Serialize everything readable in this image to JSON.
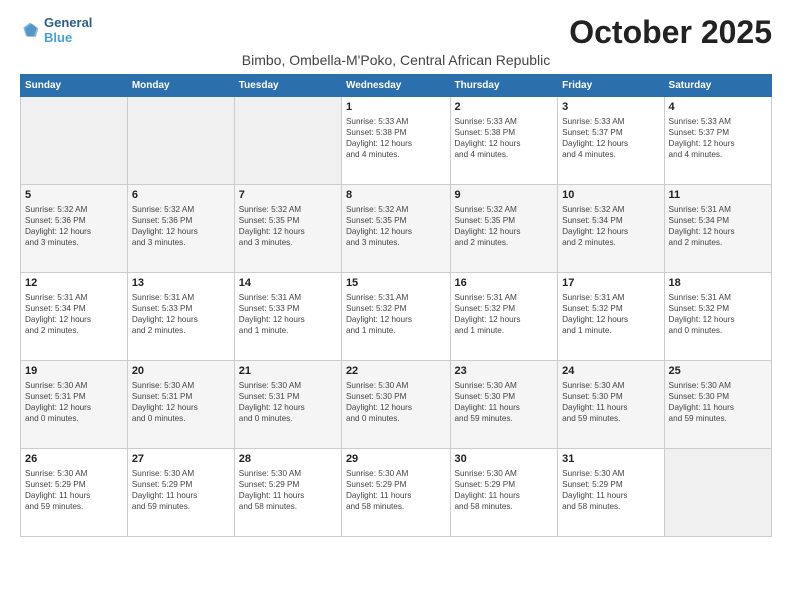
{
  "header": {
    "logo_line1": "General",
    "logo_line2": "Blue",
    "month": "October 2025",
    "location": "Bimbo, Ombella-M'Poko, Central African Republic"
  },
  "days_of_week": [
    "Sunday",
    "Monday",
    "Tuesday",
    "Wednesday",
    "Thursday",
    "Friday",
    "Saturday"
  ],
  "weeks": [
    [
      {
        "day": "",
        "info": ""
      },
      {
        "day": "",
        "info": ""
      },
      {
        "day": "",
        "info": ""
      },
      {
        "day": "1",
        "info": "Sunrise: 5:33 AM\nSunset: 5:38 PM\nDaylight: 12 hours\nand 4 minutes."
      },
      {
        "day": "2",
        "info": "Sunrise: 5:33 AM\nSunset: 5:38 PM\nDaylight: 12 hours\nand 4 minutes."
      },
      {
        "day": "3",
        "info": "Sunrise: 5:33 AM\nSunset: 5:37 PM\nDaylight: 12 hours\nand 4 minutes."
      },
      {
        "day": "4",
        "info": "Sunrise: 5:33 AM\nSunset: 5:37 PM\nDaylight: 12 hours\nand 4 minutes."
      }
    ],
    [
      {
        "day": "5",
        "info": "Sunrise: 5:32 AM\nSunset: 5:36 PM\nDaylight: 12 hours\nand 3 minutes."
      },
      {
        "day": "6",
        "info": "Sunrise: 5:32 AM\nSunset: 5:36 PM\nDaylight: 12 hours\nand 3 minutes."
      },
      {
        "day": "7",
        "info": "Sunrise: 5:32 AM\nSunset: 5:35 PM\nDaylight: 12 hours\nand 3 minutes."
      },
      {
        "day": "8",
        "info": "Sunrise: 5:32 AM\nSunset: 5:35 PM\nDaylight: 12 hours\nand 3 minutes."
      },
      {
        "day": "9",
        "info": "Sunrise: 5:32 AM\nSunset: 5:35 PM\nDaylight: 12 hours\nand 2 minutes."
      },
      {
        "day": "10",
        "info": "Sunrise: 5:32 AM\nSunset: 5:34 PM\nDaylight: 12 hours\nand 2 minutes."
      },
      {
        "day": "11",
        "info": "Sunrise: 5:31 AM\nSunset: 5:34 PM\nDaylight: 12 hours\nand 2 minutes."
      }
    ],
    [
      {
        "day": "12",
        "info": "Sunrise: 5:31 AM\nSunset: 5:34 PM\nDaylight: 12 hours\nand 2 minutes."
      },
      {
        "day": "13",
        "info": "Sunrise: 5:31 AM\nSunset: 5:33 PM\nDaylight: 12 hours\nand 2 minutes."
      },
      {
        "day": "14",
        "info": "Sunrise: 5:31 AM\nSunset: 5:33 PM\nDaylight: 12 hours\nand 1 minute."
      },
      {
        "day": "15",
        "info": "Sunrise: 5:31 AM\nSunset: 5:32 PM\nDaylight: 12 hours\nand 1 minute."
      },
      {
        "day": "16",
        "info": "Sunrise: 5:31 AM\nSunset: 5:32 PM\nDaylight: 12 hours\nand 1 minute."
      },
      {
        "day": "17",
        "info": "Sunrise: 5:31 AM\nSunset: 5:32 PM\nDaylight: 12 hours\nand 1 minute."
      },
      {
        "day": "18",
        "info": "Sunrise: 5:31 AM\nSunset: 5:32 PM\nDaylight: 12 hours\nand 0 minutes."
      }
    ],
    [
      {
        "day": "19",
        "info": "Sunrise: 5:30 AM\nSunset: 5:31 PM\nDaylight: 12 hours\nand 0 minutes."
      },
      {
        "day": "20",
        "info": "Sunrise: 5:30 AM\nSunset: 5:31 PM\nDaylight: 12 hours\nand 0 minutes."
      },
      {
        "day": "21",
        "info": "Sunrise: 5:30 AM\nSunset: 5:31 PM\nDaylight: 12 hours\nand 0 minutes."
      },
      {
        "day": "22",
        "info": "Sunrise: 5:30 AM\nSunset: 5:30 PM\nDaylight: 12 hours\nand 0 minutes."
      },
      {
        "day": "23",
        "info": "Sunrise: 5:30 AM\nSunset: 5:30 PM\nDaylight: 11 hours\nand 59 minutes."
      },
      {
        "day": "24",
        "info": "Sunrise: 5:30 AM\nSunset: 5:30 PM\nDaylight: 11 hours\nand 59 minutes."
      },
      {
        "day": "25",
        "info": "Sunrise: 5:30 AM\nSunset: 5:30 PM\nDaylight: 11 hours\nand 59 minutes."
      }
    ],
    [
      {
        "day": "26",
        "info": "Sunrise: 5:30 AM\nSunset: 5:29 PM\nDaylight: 11 hours\nand 59 minutes."
      },
      {
        "day": "27",
        "info": "Sunrise: 5:30 AM\nSunset: 5:29 PM\nDaylight: 11 hours\nand 59 minutes."
      },
      {
        "day": "28",
        "info": "Sunrise: 5:30 AM\nSunset: 5:29 PM\nDaylight: 11 hours\nand 58 minutes."
      },
      {
        "day": "29",
        "info": "Sunrise: 5:30 AM\nSunset: 5:29 PM\nDaylight: 11 hours\nand 58 minutes."
      },
      {
        "day": "30",
        "info": "Sunrise: 5:30 AM\nSunset: 5:29 PM\nDaylight: 11 hours\nand 58 minutes."
      },
      {
        "day": "31",
        "info": "Sunrise: 5:30 AM\nSunset: 5:29 PM\nDaylight: 11 hours\nand 58 minutes."
      },
      {
        "day": "",
        "info": ""
      }
    ]
  ]
}
